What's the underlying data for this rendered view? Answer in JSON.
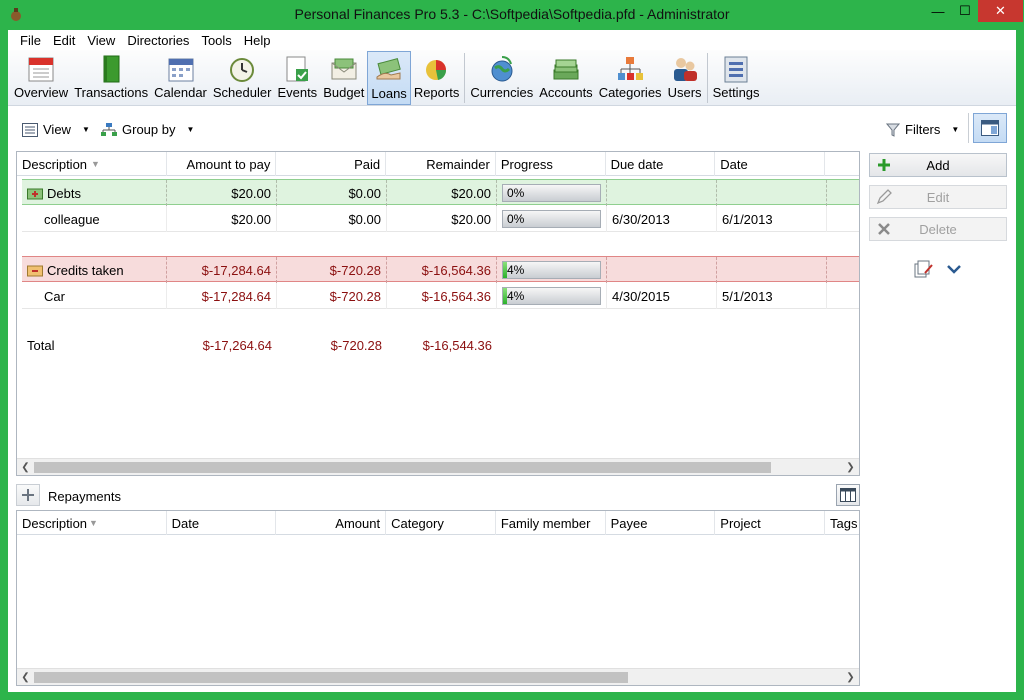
{
  "window": {
    "title": "Personal Finances Pro 5.3 - C:\\Softpedia\\Softpedia.pfd - Administrator",
    "minimize_glyph": "—",
    "maximize_glyph": "☐",
    "close_glyph": "✕"
  },
  "menu": [
    "File",
    "Edit",
    "View",
    "Directories",
    "Tools",
    "Help"
  ],
  "toolbar": [
    {
      "label": "Overview",
      "icon": "calendar-page-icon"
    },
    {
      "label": "Transactions",
      "icon": "green-book-icon"
    },
    {
      "label": "Calendar",
      "icon": "calendar-icon"
    },
    {
      "label": "Scheduler",
      "icon": "clock-icon"
    },
    {
      "label": "Events",
      "icon": "events-check-icon"
    },
    {
      "label": "Budget",
      "icon": "envelope-money-icon"
    },
    {
      "label": "Loans",
      "icon": "money-hand-icon",
      "active": true
    },
    {
      "label": "Reports",
      "icon": "pie-chart-icon"
    },
    {
      "label": "Currencies",
      "icon": "globe-currency-icon"
    },
    {
      "label": "Accounts",
      "icon": "cash-stack-icon"
    },
    {
      "label": "Categories",
      "icon": "category-tree-icon"
    },
    {
      "label": "Users",
      "icon": "users-icon"
    },
    {
      "label": "Settings",
      "icon": "settings-panel-icon"
    }
  ],
  "subbar": {
    "view_label": "View",
    "groupby_label": "Group by",
    "filters_label": "Filters"
  },
  "loans_grid": {
    "columns": [
      "Description",
      "Amount to pay",
      "Paid",
      "Remainder",
      "Progress",
      "Due date",
      "Date"
    ],
    "rows": [
      {
        "kind": "debts-group",
        "description": "Debts",
        "amount": "$20.00",
        "paid": "$0.00",
        "remainder": "$20.00",
        "progress_text": "0%",
        "progress": 0,
        "due": "",
        "date": ""
      },
      {
        "kind": "plain",
        "description": "colleague",
        "amount": "$20.00",
        "paid": "$0.00",
        "remainder": "$20.00",
        "progress_text": "0%",
        "progress": 0,
        "due": "6/30/2013",
        "date": "6/1/2013"
      },
      {
        "kind": "credit-group",
        "description": "Credits taken",
        "amount": "$-17,284.64",
        "paid": "$-720.28",
        "remainder": "$-16,564.36",
        "progress_text": "4%",
        "progress": 4,
        "due": "",
        "date": ""
      },
      {
        "kind": "plain-neg",
        "description": "Car",
        "amount": "$-17,284.64",
        "paid": "$-720.28",
        "remainder": "$-16,564.36",
        "progress_text": "4%",
        "progress": 4,
        "due": "4/30/2015",
        "date": "5/1/2013"
      }
    ],
    "total": {
      "label": "Total",
      "amount": "$-17,264.64",
      "paid": "$-720.28",
      "remainder": "$-16,544.36"
    }
  },
  "side_actions": {
    "add_label": "Add",
    "edit_label": "Edit",
    "delete_label": "Delete"
  },
  "repayments": {
    "title": "Repayments",
    "columns": [
      "Description",
      "Date",
      "Amount",
      "Category",
      "Family member",
      "Payee",
      "Project",
      "Tags"
    ]
  }
}
